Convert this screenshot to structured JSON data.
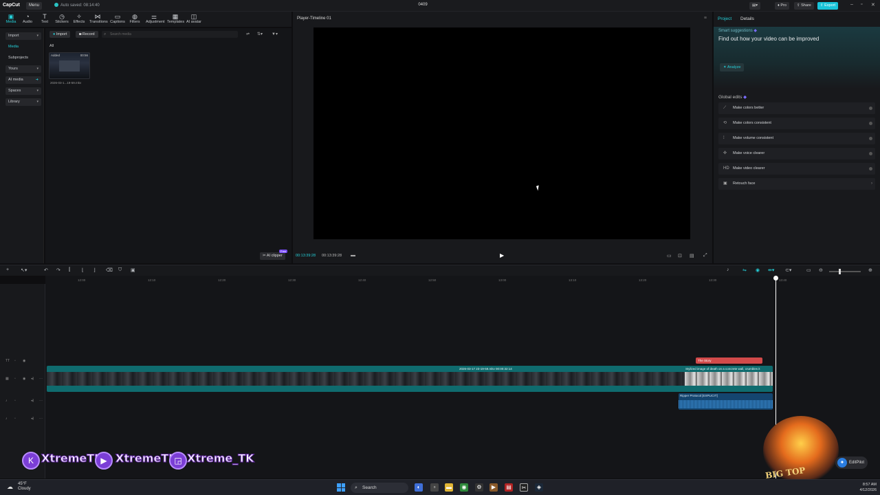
{
  "titlebar": {
    "logo": "CapCut",
    "menu": "Menu",
    "autosave": "Auto saved: 08:14:40",
    "project": "0409",
    "pro": "Pro",
    "share": "Share",
    "export": "Export"
  },
  "toolbar": {
    "tools": [
      "Media",
      "Audio",
      "Text",
      "Stickers",
      "Effects",
      "Transitions",
      "Captions",
      "Filters",
      "Adjustment",
      "Templates",
      "AI avatar"
    ]
  },
  "leftnav": {
    "import": "Import",
    "media": "Media",
    "subprojects": "Subprojects",
    "yours": "Yours",
    "ai_media": "AI media",
    "spaces": "Spaces",
    "library": "Library"
  },
  "media": {
    "import": "Import",
    "record": "Record",
    "search_placeholder": "Search media",
    "all": "All",
    "thumb_tag": "Added",
    "thumb_duration": "00:56",
    "thumb_name": "2026-03-1...19-59.mkv",
    "ai_clipper": "AI clipper",
    "free": "Free"
  },
  "player": {
    "title": "Player-Timeline 01",
    "current_time": "00:13:39:28",
    "total_time": "00:13:39:28"
  },
  "rightpanel": {
    "tab_project": "Project",
    "tab_details": "Details",
    "smart_label": "Smart suggestions",
    "smart_headline": "Find out how your video can be improved",
    "analyze": "Analyze",
    "global_label": "Global edits",
    "edits": [
      "Make colors better",
      "Make colors consistent",
      "Make volume consistent",
      "Make voice clearer",
      "Make video clearer",
      "Retouch face"
    ]
  },
  "timeline": {
    "ruler": [
      "12:00",
      "12:10",
      "12:20",
      "12:30",
      "12:40",
      "12:50",
      "13:00",
      "13:10",
      "13:20",
      "13:30",
      "13:40"
    ],
    "main_clip": "2026-03-17 23-19-59.mkv  00:00:32:14",
    "second_clip": "Stylized image of death on a concrete wall, crumbles it",
    "text_clip": "The Story",
    "audio_clip": "Ripper Protocol [EXPLICIT]"
  },
  "overlay": {
    "brand1": "XtremeTK",
    "brand2": "XtremeTK",
    "brand3": "Xtreme_TK",
    "bigtop": "BIG TOP",
    "editpilot": "EditPilot"
  },
  "taskbar": {
    "temp": "45°F",
    "weather": "Cloudy",
    "search": "Search",
    "time": "8:57 AM",
    "date": "4/12/2026"
  },
  "colors": {
    "accent": "#25d0d9",
    "export": "#19c3d9",
    "video_track": "#0f6b6e",
    "text_clip": "#d24a4a",
    "audio_track": "#14456f"
  }
}
